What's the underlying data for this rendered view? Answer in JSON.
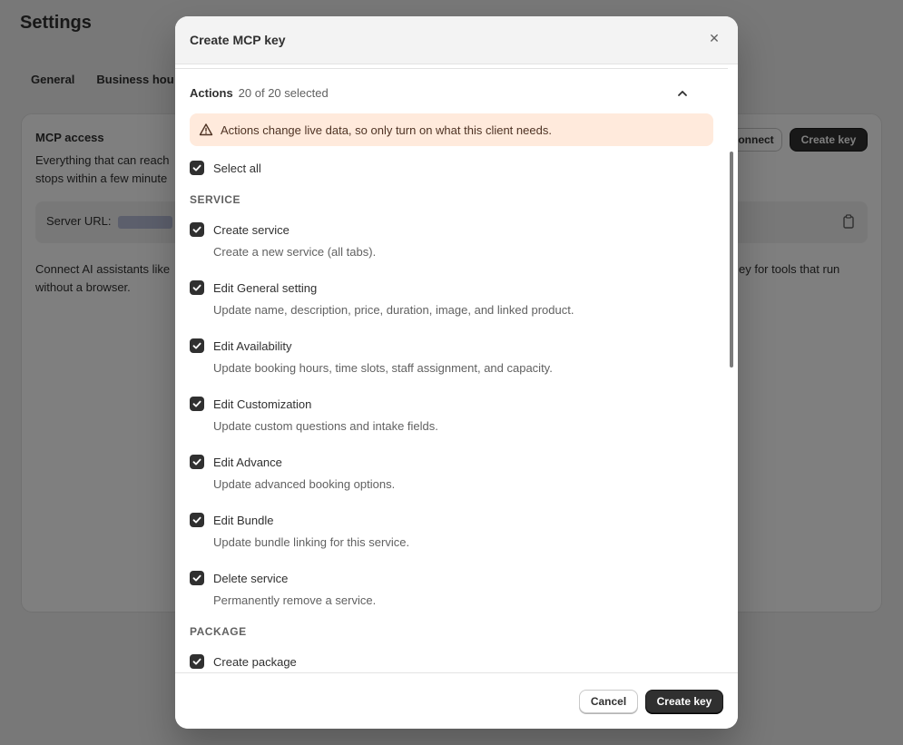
{
  "background": {
    "page_title": "Settings",
    "tabs": [
      "General",
      "Business hou"
    ],
    "card": {
      "title": "MCP access",
      "description": "Everything that can reach stops within a few minute",
      "server_url_label": "Server URL:",
      "paragraph_left": "Connect AI assistants like without a browser.",
      "paragraph_right": "ey for tools that run",
      "connect_label": "onnect",
      "create_key_label": "Create key"
    }
  },
  "modal": {
    "title": "Create MCP key",
    "close_glyph": "✕",
    "actions_label": "Actions",
    "actions_count": "20 of 20 selected",
    "warning": "Actions change live data, so only turn on what this client needs.",
    "select_all": "Select all",
    "groups": [
      {
        "name": "SERVICE",
        "items": [
          {
            "label": "Create service",
            "desc": "Create a new service (all tabs)."
          },
          {
            "label": "Edit General setting",
            "desc": "Update name, description, price, duration, image, and linked product."
          },
          {
            "label": "Edit Availability",
            "desc": "Update booking hours, time slots, staff assignment, and capacity."
          },
          {
            "label": "Edit Customization",
            "desc": "Update custom questions and intake fields."
          },
          {
            "label": "Edit Advance",
            "desc": "Update advanced booking options."
          },
          {
            "label": "Edit Bundle",
            "desc": "Update bundle linking for this service."
          },
          {
            "label": "Delete service",
            "desc": "Permanently remove a service."
          }
        ]
      },
      {
        "name": "PACKAGE",
        "items": [
          {
            "label": "Create package",
            "desc": ""
          }
        ]
      }
    ],
    "footer": {
      "cancel_label": "Cancel",
      "create_label": "Create key"
    }
  }
}
